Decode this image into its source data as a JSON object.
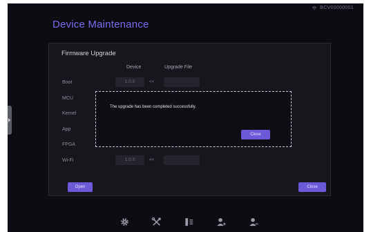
{
  "status_bar": {
    "device_id": "BCV00000001"
  },
  "page": {
    "title": "Device Maintenance"
  },
  "firmware": {
    "title": "Firmware Upgrade",
    "col_device": "Device",
    "col_file": "Upgrade File",
    "rows": [
      {
        "label": "Boot",
        "device_value": "1.0.0",
        "arrow": "<<"
      },
      {
        "label": "MCU"
      },
      {
        "label": "Kernel"
      },
      {
        "label": "App"
      },
      {
        "label": "FPGA"
      },
      {
        "label": "Wi-Fi",
        "device_value": "1.0.0",
        "arrow": "<<"
      }
    ],
    "open_label": "Open",
    "close_label": "Close"
  },
  "dialog": {
    "message": "The upgrade has been completed successfully.",
    "close_label": "Close"
  },
  "toolbar": {
    "icons": [
      "gear-icon",
      "tools-icon",
      "adjust-icon",
      "add-user-icon",
      "remove-user-icon"
    ]
  },
  "colors": {
    "accent": "#6b5ad8",
    "title": "#7a6cf0",
    "background": "#0c0c13"
  }
}
